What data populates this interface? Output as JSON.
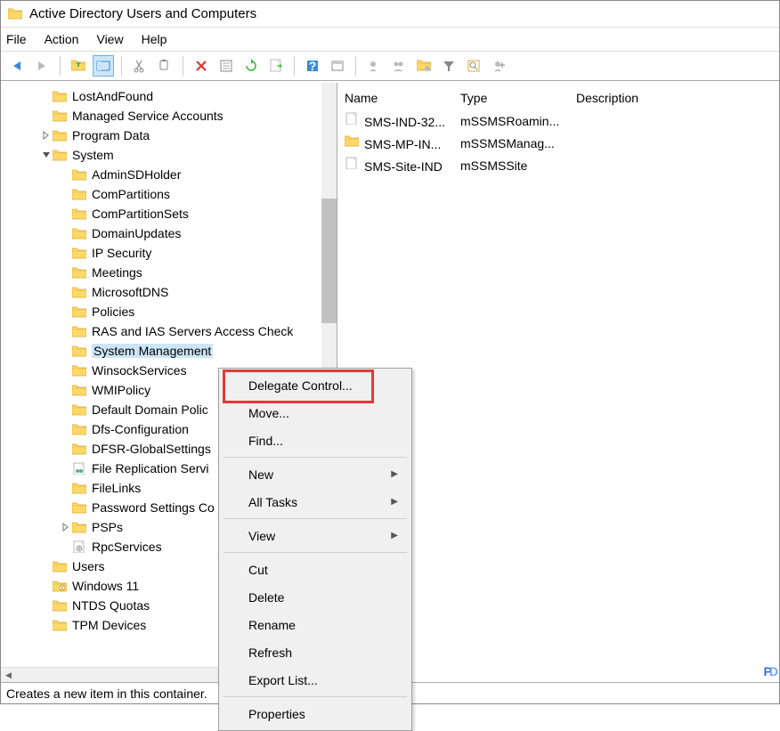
{
  "title": "Active Directory Users and Computers",
  "menus": [
    "File",
    "Action",
    "View",
    "Help"
  ],
  "toolbar_icons": [
    "back-arrow-icon",
    "forward-arrow-icon",
    "sep",
    "up-folder-icon",
    "show-hide-icon",
    "sep",
    "cut-icon",
    "copy-icon",
    "sep",
    "delete-x-icon",
    "properties-icon",
    "refresh-icon",
    "export-icon",
    "sep",
    "help-icon",
    "filter-options-icon",
    "sep",
    "add-user-icon",
    "add-group-icon",
    "add-ou-icon",
    "filter-icon",
    "find-icon",
    "add-computer-icon"
  ],
  "tree": [
    {
      "indent": 2,
      "icon": "folder-icon",
      "label": "LostAndFound",
      "exp": ""
    },
    {
      "indent": 2,
      "icon": "folder-icon",
      "label": "Managed Service Accounts",
      "exp": ""
    },
    {
      "indent": 2,
      "icon": "folder-icon",
      "label": "Program Data",
      "exp": ">"
    },
    {
      "indent": 2,
      "icon": "folder-icon",
      "label": "System",
      "exp": "v"
    },
    {
      "indent": 3,
      "icon": "folder-icon",
      "label": "AdminSDHolder",
      "exp": ""
    },
    {
      "indent": 3,
      "icon": "folder-icon",
      "label": "ComPartitions",
      "exp": ""
    },
    {
      "indent": 3,
      "icon": "folder-icon",
      "label": "ComPartitionSets",
      "exp": ""
    },
    {
      "indent": 3,
      "icon": "folder-icon",
      "label": "DomainUpdates",
      "exp": ""
    },
    {
      "indent": 3,
      "icon": "folder-icon",
      "label": "IP Security",
      "exp": ""
    },
    {
      "indent": 3,
      "icon": "folder-icon",
      "label": "Meetings",
      "exp": ""
    },
    {
      "indent": 3,
      "icon": "folder-icon",
      "label": "MicrosoftDNS",
      "exp": ""
    },
    {
      "indent": 3,
      "icon": "folder-icon",
      "label": "Policies",
      "exp": ""
    },
    {
      "indent": 3,
      "icon": "folder-icon",
      "label": "RAS and IAS Servers Access Check",
      "exp": ""
    },
    {
      "indent": 3,
      "icon": "folder-icon",
      "label": "System Management",
      "exp": "",
      "selected": true
    },
    {
      "indent": 3,
      "icon": "folder-icon",
      "label": "WinsockServices",
      "exp": ""
    },
    {
      "indent": 3,
      "icon": "folder-icon",
      "label": "WMIPolicy",
      "exp": ""
    },
    {
      "indent": 3,
      "icon": "folder-icon",
      "label": "Default Domain Polic",
      "exp": ""
    },
    {
      "indent": 3,
      "icon": "folder-icon",
      "label": "Dfs-Configuration",
      "exp": ""
    },
    {
      "indent": 3,
      "icon": "folder-icon",
      "label": "DFSR-GlobalSettings",
      "exp": ""
    },
    {
      "indent": 3,
      "icon": "service-icon",
      "label": "File Replication Servi",
      "exp": ""
    },
    {
      "indent": 3,
      "icon": "folder-icon",
      "label": "FileLinks",
      "exp": ""
    },
    {
      "indent": 3,
      "icon": "folder-icon",
      "label": "Password Settings Co",
      "exp": ""
    },
    {
      "indent": 3,
      "icon": "folder-icon",
      "label": "PSPs",
      "exp": ">"
    },
    {
      "indent": 3,
      "icon": "service2-icon",
      "label": "RpcServices",
      "exp": ""
    },
    {
      "indent": 2,
      "icon": "folder-icon",
      "label": "Users",
      "exp": ""
    },
    {
      "indent": 2,
      "icon": "ou-icon",
      "label": "Windows 11",
      "exp": ""
    },
    {
      "indent": 2,
      "icon": "folder-icon",
      "label": "NTDS Quotas",
      "exp": ""
    },
    {
      "indent": 2,
      "icon": "folder-icon",
      "label": "TPM Devices",
      "exp": ""
    }
  ],
  "list": {
    "headers": [
      "Name",
      "Type",
      "Description"
    ],
    "rows": [
      {
        "icon": "doc-icon",
        "name": "SMS-IND-32...",
        "type": "mSSMSRoamin..."
      },
      {
        "icon": "folder-icon",
        "name": "SMS-MP-IN...",
        "type": "mSSMSManag..."
      },
      {
        "icon": "doc-icon",
        "name": "SMS-Site-IND",
        "type": "mSSMSSite"
      }
    ]
  },
  "context_menu": [
    {
      "label": "Delegate Control...",
      "type": "item"
    },
    {
      "label": "Move...",
      "type": "item"
    },
    {
      "label": "Find...",
      "type": "item"
    },
    {
      "type": "sep"
    },
    {
      "label": "New",
      "type": "submenu"
    },
    {
      "label": "All Tasks",
      "type": "submenu"
    },
    {
      "type": "sep"
    },
    {
      "label": "View",
      "type": "submenu"
    },
    {
      "type": "sep"
    },
    {
      "label": "Cut",
      "type": "item"
    },
    {
      "label": "Delete",
      "type": "item"
    },
    {
      "label": "Rename",
      "type": "item"
    },
    {
      "label": "Refresh",
      "type": "item"
    },
    {
      "label": "Export List...",
      "type": "item"
    },
    {
      "type": "sep"
    },
    {
      "label": "Properties",
      "type": "item"
    }
  ],
  "status": "Creates a new item in this container.",
  "watermark": "PD"
}
